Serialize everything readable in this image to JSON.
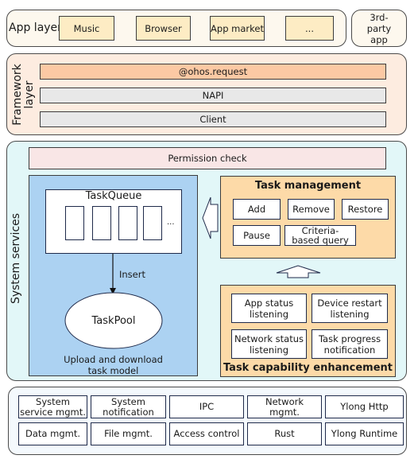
{
  "app_layer": {
    "label": "App layer",
    "apps": [
      "Music",
      "Browser",
      "App market",
      "..."
    ],
    "third_party": "3rd-party app"
  },
  "framework_layer": {
    "label_line1": "Framework",
    "label_line2": "layer",
    "bars": [
      "@ohos.request",
      "NAPI",
      "Client"
    ]
  },
  "system_services": {
    "label": "System services",
    "permission_check": "Permission check",
    "task_model": {
      "queue_title": "TaskQueue",
      "queue_ellipsis": "...",
      "insert_label": "Insert",
      "pool_label": "TaskPool",
      "caption_line1": "Upload and download",
      "caption_line2": "task model"
    },
    "task_management": {
      "title": "Task management",
      "actions": [
        "Add",
        "Remove",
        "Restore",
        "Pause",
        "Criteria-based query"
      ]
    },
    "task_capability": {
      "title": "Task capability enhancement",
      "items": [
        {
          "line1": "App status",
          "line2": "listening"
        },
        {
          "line1": "Device restart",
          "line2": "listening"
        },
        {
          "line1": "Network status",
          "line2": "listening"
        },
        {
          "line1": "Task progress",
          "line2": "notification"
        }
      ]
    }
  },
  "base_layer": {
    "row1": [
      {
        "line1": "System",
        "line2": "service mgmt."
      },
      {
        "line1": "System",
        "line2": "notification"
      },
      {
        "line1": "IPC",
        "line2": ""
      },
      {
        "line1": "Network",
        "line2": "mgmt."
      },
      {
        "line1": "Ylong Http",
        "line2": ""
      }
    ],
    "row2": [
      "Data mgmt.",
      "File mgmt.",
      "Access control",
      "Rust",
      "Ylong Runtime"
    ]
  },
  "colors": {
    "app_box": "#fdecc4",
    "request_bar": "#fcc9a4",
    "gray_bar": "#e8e8e8",
    "permission": "#f9e6e6",
    "task_model": "#acd2f2",
    "orange_panel": "#fddaa8",
    "system_bg": "#e2f7f8"
  }
}
